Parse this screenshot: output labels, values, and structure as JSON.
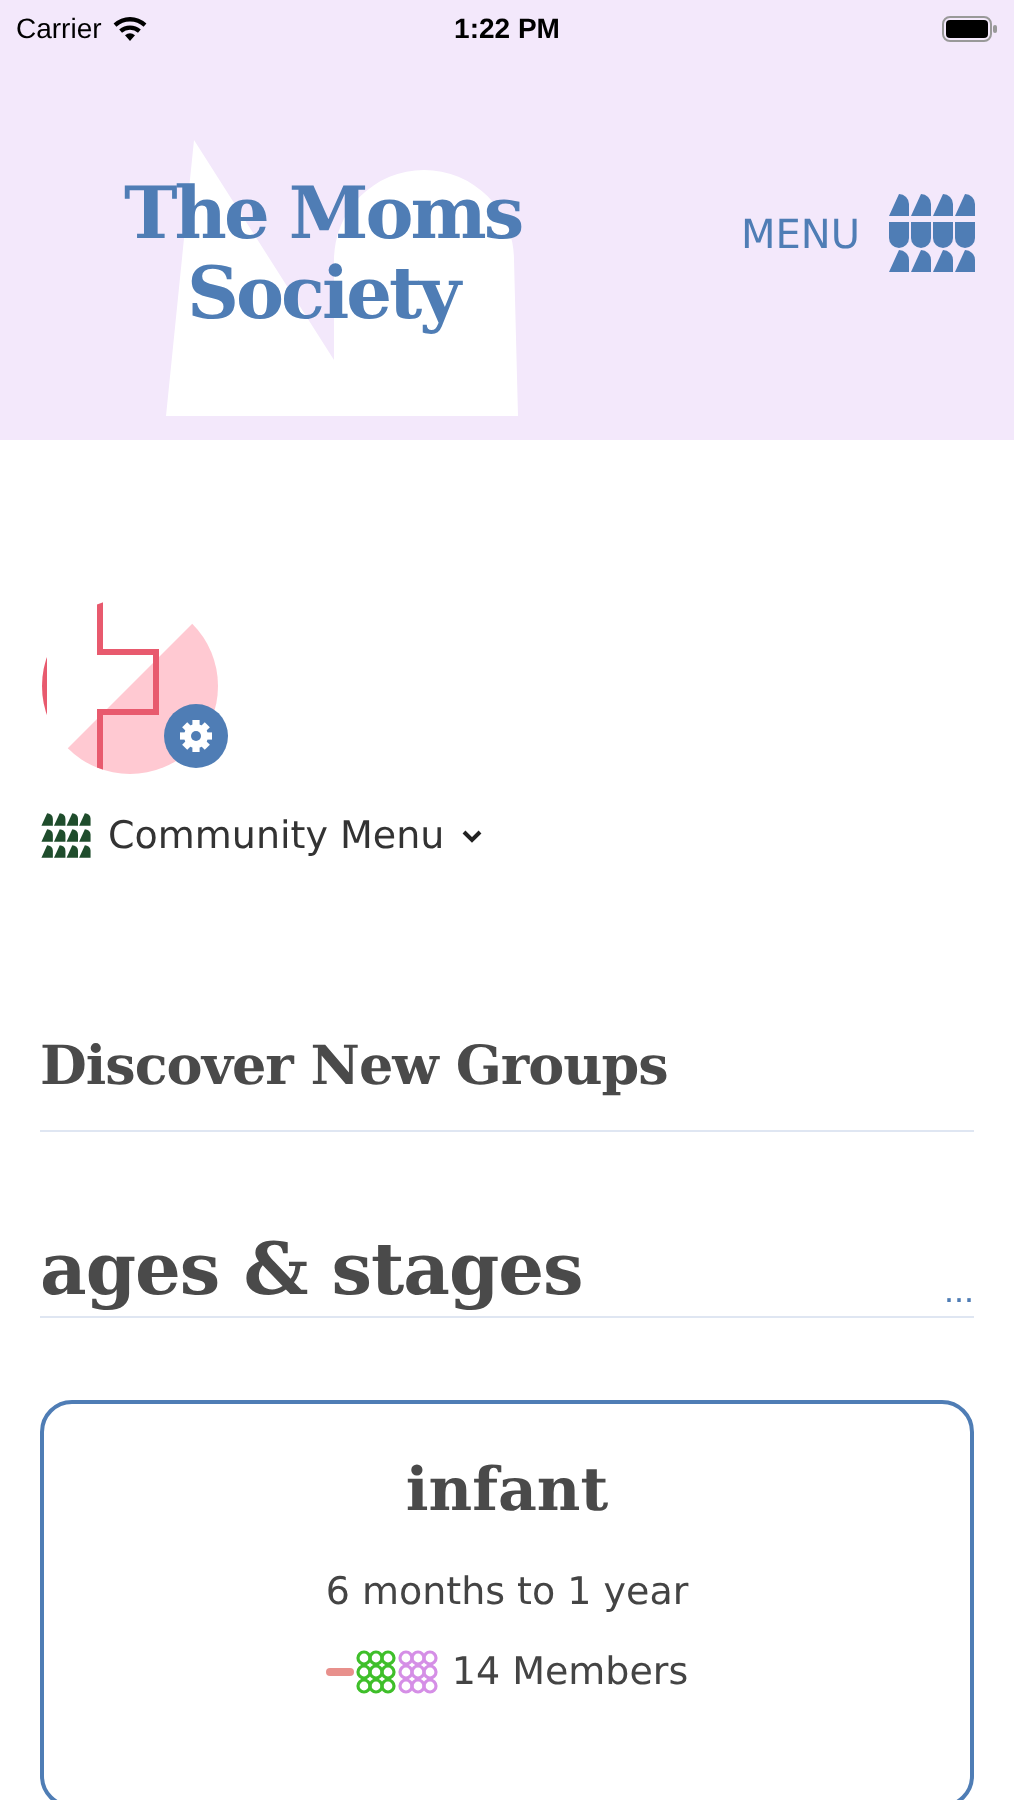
{
  "status_bar": {
    "carrier": "Carrier",
    "time": "1:22 PM"
  },
  "header": {
    "logo": [
      "The Moms",
      "Society"
    ],
    "menu_label": "MENU"
  },
  "community_menu": {
    "label": "Community Menu"
  },
  "section_title": "Discover New Groups",
  "category": {
    "title": "ages & stages",
    "more": "..."
  },
  "group_card": {
    "title": "infant",
    "subtitle": "6 months to 1 year",
    "members": "14 Members",
    "member_avatars": [
      {
        "color": "#e8908c"
      },
      {
        "color": "#3fbf2a"
      },
      {
        "color": "#d58fe6"
      }
    ]
  }
}
